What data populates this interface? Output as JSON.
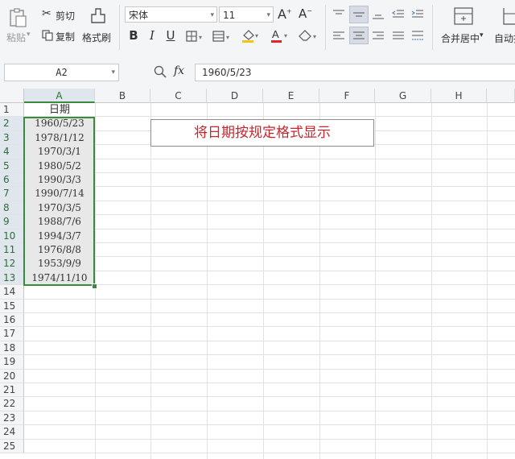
{
  "ribbon": {
    "clipboard": {
      "paste": "粘贴",
      "cut": "剪切",
      "copy": "复制",
      "format_painter": "格式刷"
    },
    "font": {
      "name": "宋体",
      "size": "11",
      "bold": "B",
      "italic": "I",
      "underline": "U",
      "grow": "A⁺",
      "shrink": "A⁻"
    },
    "alignment": {
      "merge_center": "合并居中",
      "wrap": "自动换"
    }
  },
  "formula_bar": {
    "name_box": "A2",
    "fx": "fx",
    "value": "1960/5/23"
  },
  "columns": [
    "A",
    "B",
    "C",
    "D",
    "E",
    "F",
    "G",
    "H"
  ],
  "rows": [
    "1",
    "2",
    "3",
    "4",
    "5",
    "6",
    "7",
    "8",
    "9",
    "10",
    "11",
    "12",
    "13",
    "14",
    "15",
    "16",
    "17",
    "18",
    "19",
    "20",
    "21",
    "22",
    "23",
    "24",
    "25"
  ],
  "cells": {
    "A1": "日期",
    "A_values": [
      "1960/5/23",
      "1978/1/12",
      "1970/3/1",
      "1980/5/2",
      "1990/3/3",
      "1990/7/14",
      "1970/3/5",
      "1988/7/6",
      "1994/3/7",
      "1976/8/8",
      "1953/9/9",
      "1974/11/10"
    ]
  },
  "textbox": {
    "text": "将日期按规定格式显示"
  },
  "colors": {
    "selection": "#3c8a3f",
    "textbox_text": "#c8262e"
  }
}
